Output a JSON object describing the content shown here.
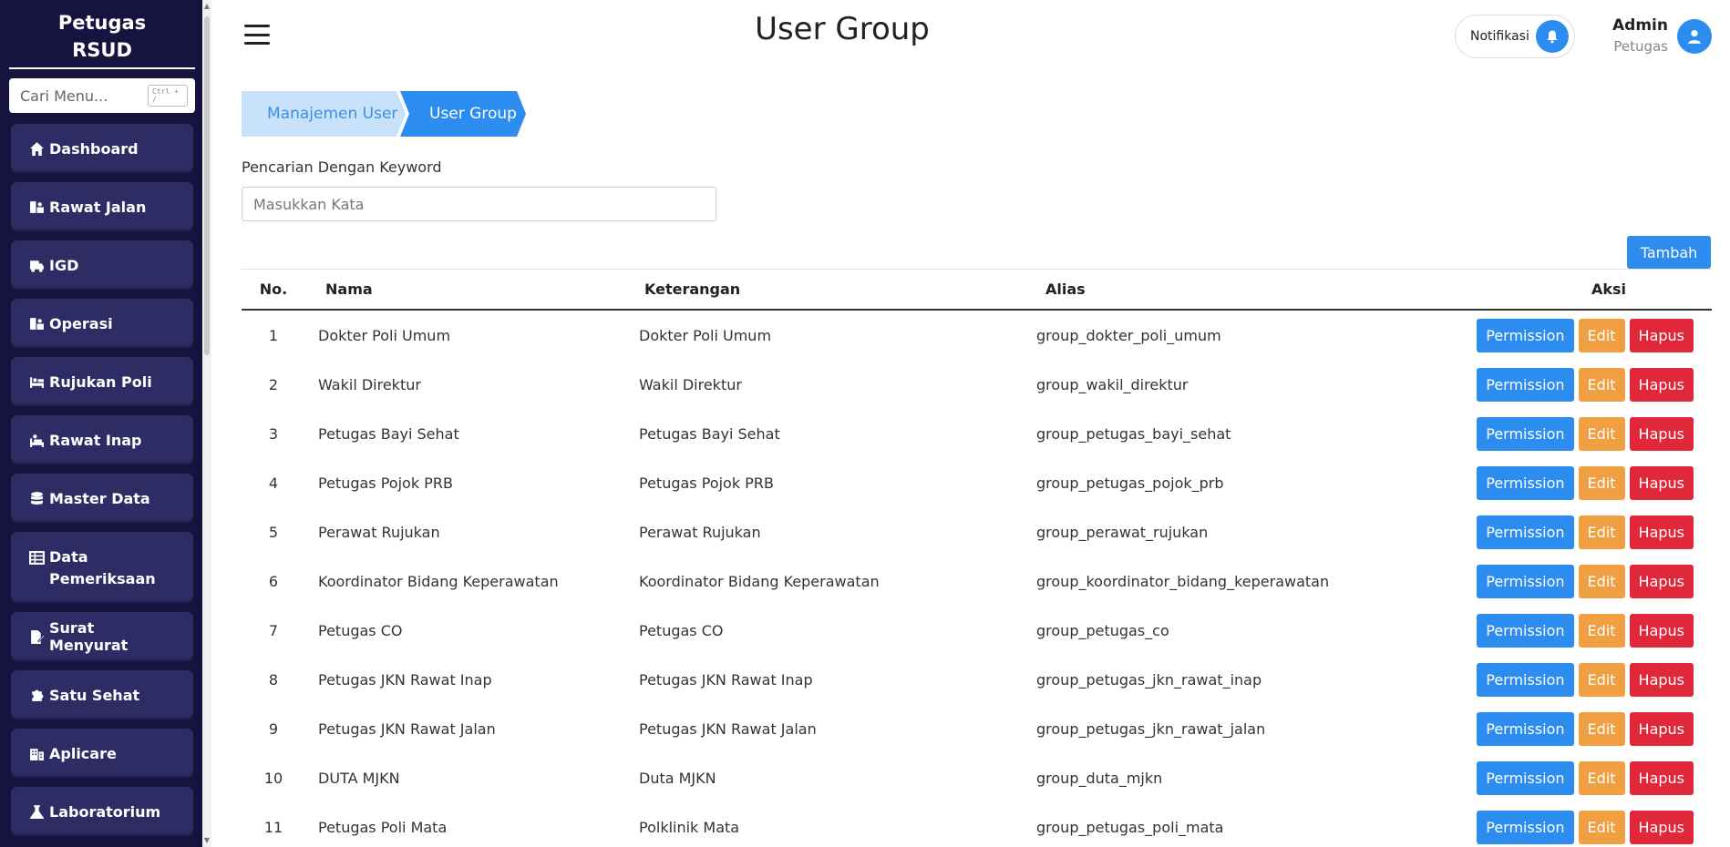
{
  "sidebar": {
    "brand_line1": "Petugas",
    "brand_line2": "RSUD",
    "search_placeholder": "Cari Menu...",
    "search_shortcut": "Ctrl + /",
    "items": [
      {
        "label": "Dashboard",
        "icon": "home-icon"
      },
      {
        "label": "Rawat Jalan",
        "icon": "patient-icon"
      },
      {
        "label": "IGD",
        "icon": "ambulance-icon"
      },
      {
        "label": "Operasi",
        "icon": "surgery-icon"
      },
      {
        "label": "Rujukan Poli",
        "icon": "bed-icon"
      },
      {
        "label": "Rawat Inap",
        "icon": "inpatient-icon"
      },
      {
        "label": "Master Data",
        "icon": "database-icon"
      },
      {
        "label": "Data Pemeriksaan",
        "icon": "table-icon"
      },
      {
        "label": "Surat Menyurat",
        "icon": "file-signature-icon"
      },
      {
        "label": "Satu Sehat",
        "icon": "puzzle-icon"
      },
      {
        "label": "Aplicare",
        "icon": "hospital-icon"
      },
      {
        "label": "Laboratorium",
        "icon": "flask-icon"
      }
    ]
  },
  "header": {
    "title": "User Group",
    "notification_label": "Notifikasi",
    "user_name": "Admin",
    "user_role": "Petugas"
  },
  "breadcrumb": [
    "Manajemen User",
    "User Group"
  ],
  "search": {
    "label": "Pencarian Dengan Keyword",
    "placeholder": "Masukkan Kata"
  },
  "add_button": "Tambah",
  "table": {
    "headers": [
      "No.",
      "Nama",
      "Keterangan",
      "Alias",
      "Aksi"
    ],
    "actions": [
      "Permission",
      "Edit",
      "Hapus"
    ],
    "rows": [
      {
        "no": "1",
        "nama": "Dokter Poli Umum",
        "keterangan": "Dokter Poli Umum",
        "alias": "group_dokter_poli_umum"
      },
      {
        "no": "2",
        "nama": "Wakil Direktur",
        "keterangan": "Wakil Direktur",
        "alias": "group_wakil_direktur"
      },
      {
        "no": "3",
        "nama": "Petugas Bayi Sehat",
        "keterangan": "Petugas Bayi Sehat",
        "alias": "group_petugas_bayi_sehat"
      },
      {
        "no": "4",
        "nama": "Petugas Pojok PRB",
        "keterangan": "Petugas Pojok PRB",
        "alias": "group_petugas_pojok_prb"
      },
      {
        "no": "5",
        "nama": "Perawat Rujukan",
        "keterangan": "Perawat Rujukan",
        "alias": "group_perawat_rujukan"
      },
      {
        "no": "6",
        "nama": "Koordinator Bidang Keperawatan",
        "keterangan": "Koordinator Bidang Keperawatan",
        "alias": "group_koordinator_bidang_keperawatan"
      },
      {
        "no": "7",
        "nama": "Petugas CO",
        "keterangan": "Petugas CO",
        "alias": "group_petugas_co"
      },
      {
        "no": "8",
        "nama": "Petugas JKN Rawat Inap",
        "keterangan": "Petugas JKN Rawat Inap",
        "alias": "group_petugas_jkn_rawat_inap"
      },
      {
        "no": "9",
        "nama": "Petugas JKN Rawat Jalan",
        "keterangan": "Petugas JKN Rawat Jalan",
        "alias": "group_petugas_jkn_rawat_jalan"
      },
      {
        "no": "10",
        "nama": "DUTA MJKN",
        "keterangan": "Duta MJKN",
        "alias": "group_duta_mjkn"
      },
      {
        "no": "11",
        "nama": "Petugas Poli Mata",
        "keterangan": "Polklinik Mata",
        "alias": "group_petugas_poli_mata"
      }
    ]
  },
  "colors": {
    "sidebar_bg": "#16143f",
    "sidebar_item_bg": "#2e2c64",
    "primary": "#2d8cf0",
    "warning": "#f0a043",
    "danger": "#e0283a",
    "breadcrumb_light": "#c9e2fb"
  }
}
